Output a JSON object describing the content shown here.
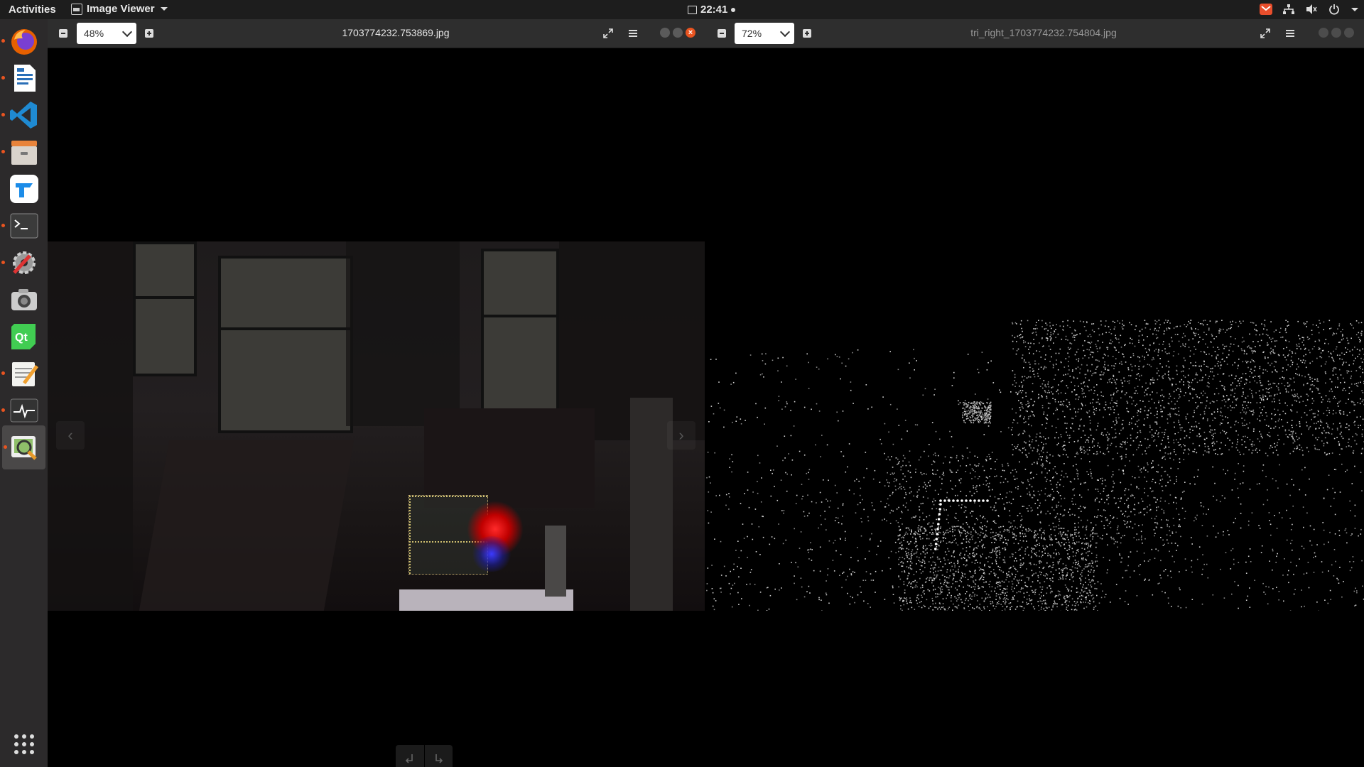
{
  "topbar": {
    "activities": "Activities",
    "app_name": "Image Viewer",
    "clock": "22:41"
  },
  "dock": {
    "items": [
      {
        "name": "firefox",
        "running": true
      },
      {
        "name": "libreoffice-writer",
        "running": true
      },
      {
        "name": "vscode",
        "running": true
      },
      {
        "name": "files",
        "running": true
      },
      {
        "name": "teamviewer",
        "running": false
      },
      {
        "name": "terminal",
        "running": true
      },
      {
        "name": "settings-tools",
        "running": true
      },
      {
        "name": "screenshot",
        "running": false
      },
      {
        "name": "qt-creator",
        "running": false
      },
      {
        "name": "text-editor",
        "running": true
      },
      {
        "name": "system-monitor",
        "running": true
      },
      {
        "name": "image-viewer",
        "running": true,
        "active": true
      }
    ],
    "show_apps": "show-applications"
  },
  "left_window": {
    "zoom": "48%",
    "filename": "1703774232.753869.jpg"
  },
  "right_window": {
    "zoom": "72%",
    "filename": "tri_right_1703774232.754804.jpg"
  },
  "colors": {
    "accent": "#e95420",
    "topbar": "#1d1d1d",
    "dock": "#2c2a2b",
    "headerbar": "#2e2e2e"
  }
}
